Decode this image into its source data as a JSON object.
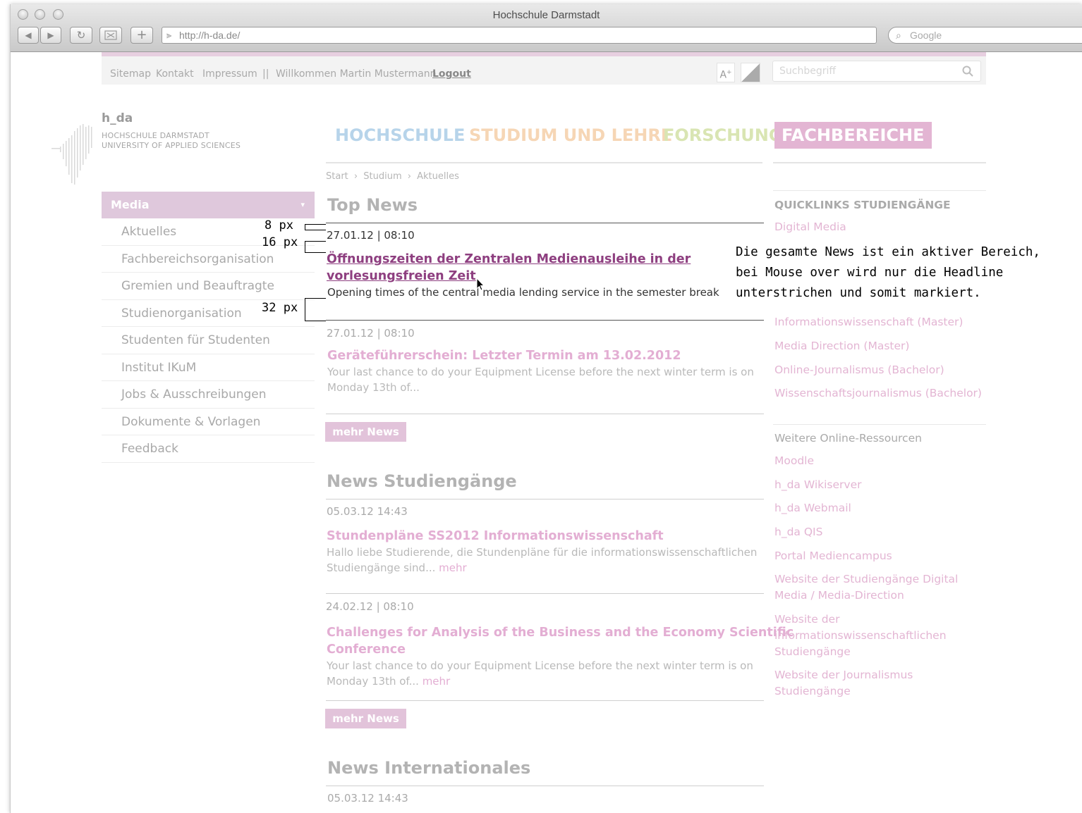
{
  "browser": {
    "window_title": "Hochschule Darmstadt",
    "url": "http://h-da.de/",
    "search_placeholder": "Google",
    "back": "◀",
    "forward": "▶",
    "reload": "↻",
    "add": "+"
  },
  "topbar": {
    "links": [
      "Sitemap",
      "Kontakt",
      "Impressum"
    ],
    "separator": "||",
    "welcome": "Willkommen Martin Mustermann",
    "logout": "Logout",
    "font_size_label": "A",
    "font_size_sup": "+",
    "search_placeholder": "Suchbegriff"
  },
  "logo": {
    "name": "h_da",
    "line1": "HOCHSCHULE DARMSTADT",
    "line2": "UNIVERSITY OF APPLIED SCIENCES"
  },
  "main_nav": [
    {
      "label": "HOCHSCHULE",
      "color": "#b7d4ea"
    },
    {
      "label": "STUDIUM UND LEHRE",
      "color": "#f6d6b5"
    },
    {
      "label": "FORSCHUNG",
      "color": "#d9e5b3"
    },
    {
      "label": "FACHBEREICHE",
      "color": "#e3b5d3"
    }
  ],
  "breadcrumb": [
    "Start",
    "Studium",
    "Aktuelles"
  ],
  "breadcrumb_sep": "›",
  "left_nav": {
    "head": "Media",
    "items": [
      "Aktuelles",
      "Fachbereichsorganisation",
      "Gremien und Beauftragte",
      "Studienorganisation",
      "Studenten für Studenten",
      "Institut IKuM",
      "Jobs & Ausschreibungen",
      "Dokumente & Vorlagen",
      "Feedback"
    ]
  },
  "top_news": {
    "title": "Top News",
    "items": [
      {
        "date": "27.01.12 | 08:10",
        "headline_line1": "Öffnungszeiten der Zentralen Medienausleihe in der",
        "headline_line2": "vorlesungsfreien Zeit",
        "teaser": "Opening times of the central media lending service in the semester break"
      },
      {
        "date": "27.01.12 | 08:10",
        "headline": "Geräteführerschein: Letzter Termin am 13.02.2012",
        "teaser_line1": "Your last chance to do your Equipment License before the next winter term is on",
        "teaser_line2": "Monday 13th of..."
      }
    ],
    "more_button": "mehr News"
  },
  "news_studiengaenge": {
    "title": "News Studiengänge",
    "items": [
      {
        "date": "05.03.12 14:43",
        "headline": "Stundenpläne SS2012 Informationswissenschaft",
        "teaser_line1": "Hallo liebe Studierende, die Stundenpläne für die informationswissenschaftlichen",
        "teaser_line2": "Studiengänge sind...",
        "more": "mehr"
      },
      {
        "date": "24.02.12 | 08:10",
        "headline_line1": "Challenges for Analysis of the Business and the Economy Scientific",
        "headline_line2": "Conference",
        "teaser_line1": "Your last chance to do your Equipment License before the next winter term is on",
        "teaser_line2": "Monday 13th of...",
        "more": "mehr"
      }
    ],
    "more_button": "mehr News"
  },
  "news_internationales": {
    "title": "News Internationales",
    "date": "05.03.12 14:43"
  },
  "quicklinks": {
    "title": "QUICKLINKS STUDIENGÄNGE",
    "items": [
      "Digital Media",
      "Informationswissenschaft (Master)",
      "Media Direction (Master)",
      "Online-Journalismus (Bachelor)",
      "Wissenschaftsjournalismus (Bachelor)"
    ]
  },
  "resources": {
    "title": "Weitere Online-Ressourcen",
    "items": [
      "Moodle",
      "h_da Wikiserver",
      "h_da Webmail",
      "h_da QIS",
      "Portal Mediencampus",
      "Website der Studiengänge Digital Media / Media-Direction",
      "Website der informationswissenschaftlichen Studiengänge",
      "Website der Journalismus Studiengänge"
    ]
  },
  "annotations": {
    "gap1": "8 px",
    "gap2": "16 px",
    "gap3": "32 px",
    "note_line1": "Die gesamte News ist ein aktiver Bereich,",
    "note_line2": "bei Mouse over wird nur die Headline",
    "note_line3": "unterstrichen und somit markiert."
  }
}
